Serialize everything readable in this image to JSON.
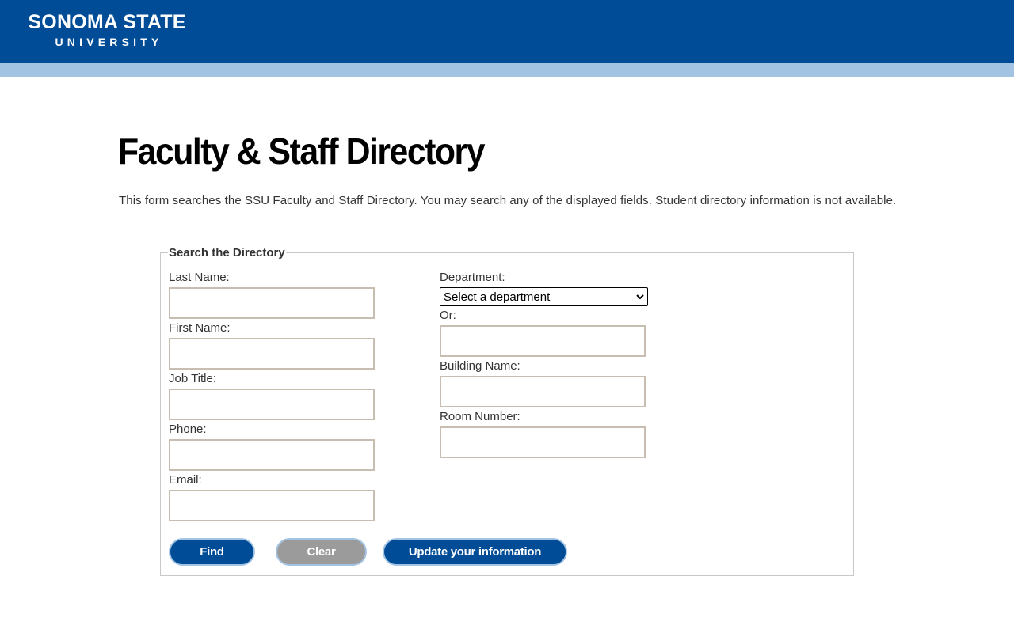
{
  "header": {
    "logo_line1": "SONOMA STATE",
    "logo_line2": "UNIVERSITY",
    "bar_color": "#004c97",
    "stripe_color": "#a3c3e3"
  },
  "page": {
    "title": "Faculty & Staff Directory",
    "intro": "This form searches the SSU Faculty and Staff Directory. You may search any of the displayed fields. Student directory information is not available."
  },
  "form": {
    "legend": "Search the Directory",
    "left_fields": [
      {
        "label": "Last Name:",
        "value": ""
      },
      {
        "label": "First Name:",
        "value": ""
      },
      {
        "label": "Job Title:",
        "value": ""
      },
      {
        "label": "Phone:",
        "value": ""
      },
      {
        "label": "Email:",
        "value": ""
      }
    ],
    "department": {
      "label": "Department:",
      "selected": "Select a department"
    },
    "or_label": "Or:",
    "right_fields": [
      {
        "label": "Building Name:",
        "value": ""
      },
      {
        "label": "Room Number:",
        "value": ""
      }
    ],
    "buttons": {
      "find": "Find",
      "clear": "Clear",
      "update": "Update your information"
    }
  },
  "colors": {
    "primary_button": "#004c97",
    "secondary_button": "#9b9b9b",
    "input_border": "#c7beb1"
  }
}
